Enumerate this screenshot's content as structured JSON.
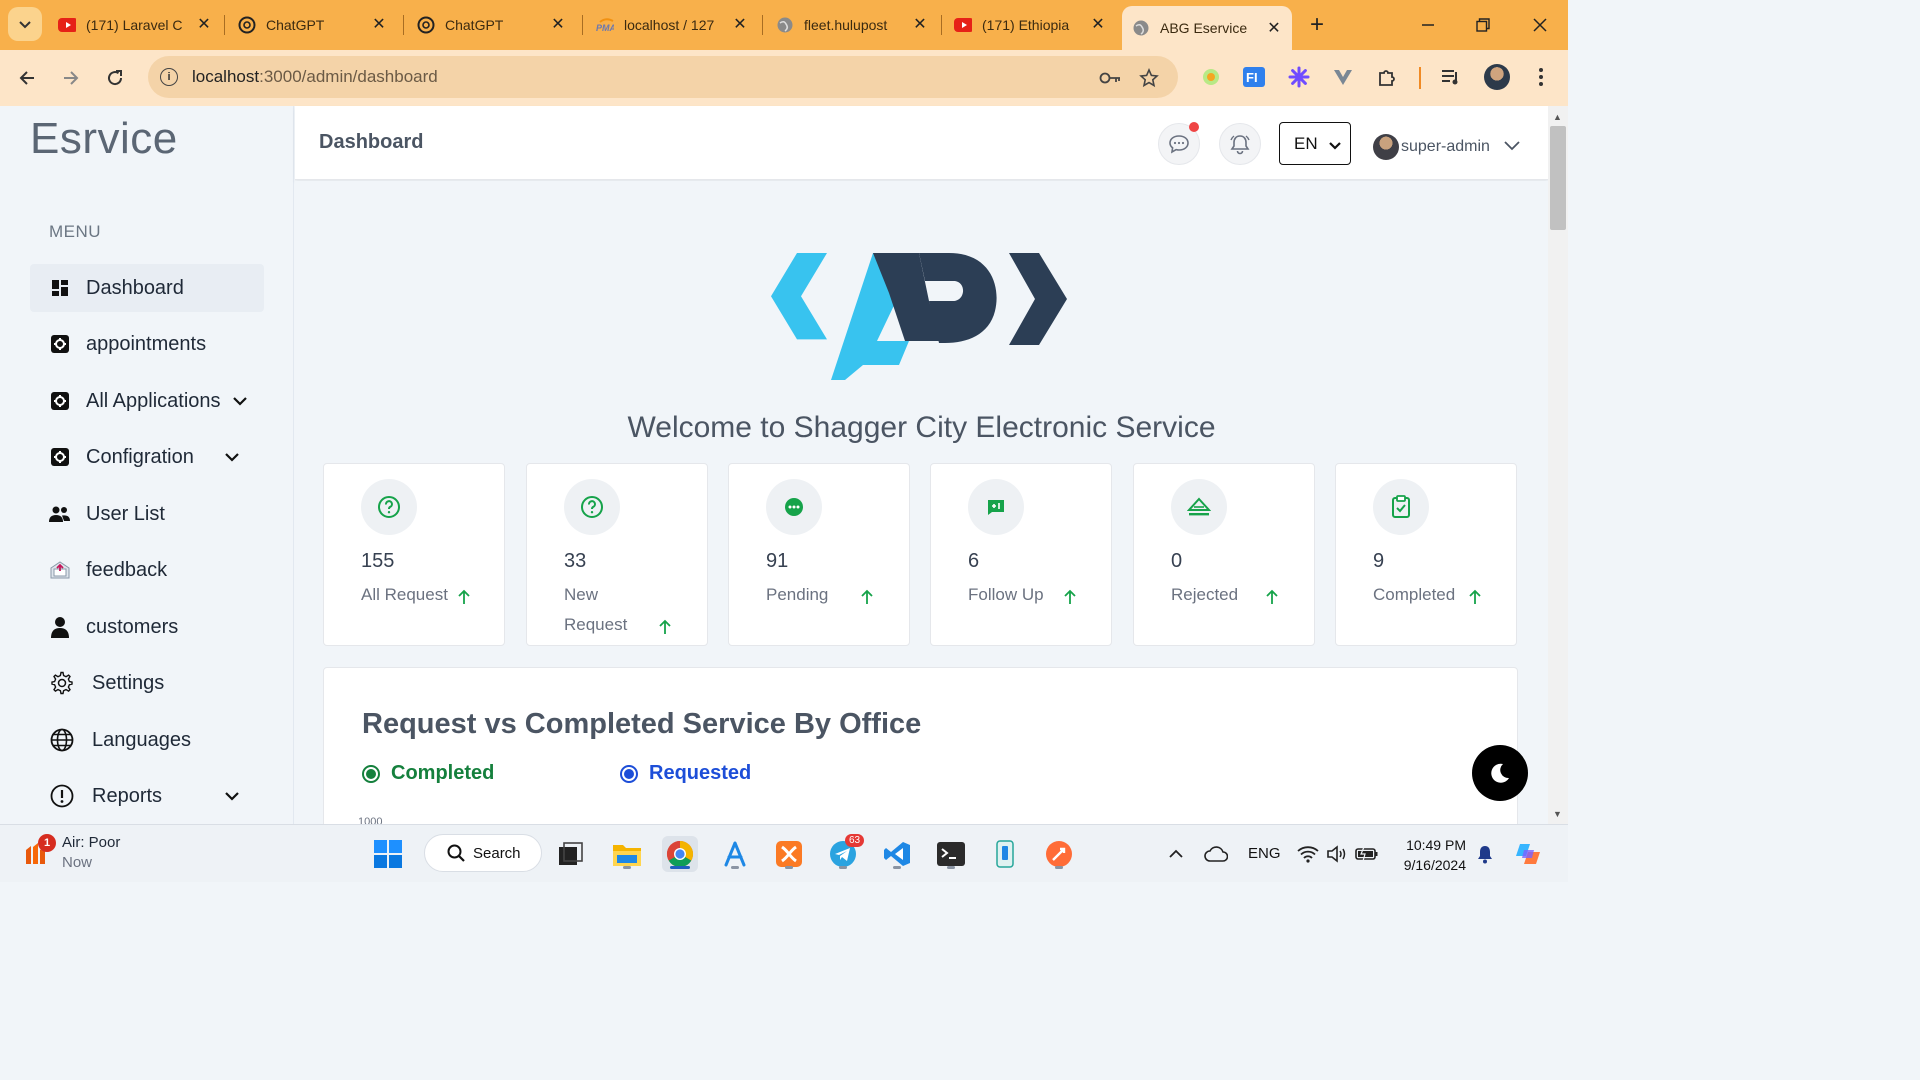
{
  "browser": {
    "tabs": [
      {
        "label": "(171) Laravel C",
        "favicon": "youtube-icon"
      },
      {
        "label": "ChatGPT",
        "favicon": "chatgpt-icon"
      },
      {
        "label": "ChatGPT",
        "favicon": "chatgpt-icon"
      },
      {
        "label": "localhost / 127",
        "favicon": "phpmyadmin-icon"
      },
      {
        "label": "fleet.hulupost",
        "favicon": "globe-icon"
      },
      {
        "label": "(171) Ethiopia",
        "favicon": "youtube-icon"
      },
      {
        "label": "ABG Eservice",
        "favicon": "globe-icon",
        "active": true
      }
    ],
    "close_glyph": "✕",
    "new_tab_glyph": "+",
    "url_host": "localhost",
    "url_path": ":3000/admin/dashboard"
  },
  "sidebar": {
    "brand": "Esrvice",
    "menu_title": "MENU",
    "items": [
      {
        "label": "Dashboard",
        "icon": "grid-icon",
        "active": true
      },
      {
        "label": "appointments",
        "icon": "cog-box-icon"
      },
      {
        "label": "All Applications",
        "icon": "cog-box-icon",
        "dropdown": true
      },
      {
        "label": "Configration",
        "icon": "cog-box-icon",
        "dropdown": true
      },
      {
        "label": "User List",
        "icon": "users-icon"
      },
      {
        "label": "feedback",
        "icon": "feedback-icon"
      },
      {
        "label": "customers",
        "icon": "user-icon"
      },
      {
        "label": "Settings",
        "icon": "gear-icon"
      },
      {
        "label": "Languages",
        "icon": "globe-icon"
      },
      {
        "label": "Reports",
        "icon": "alert-icon",
        "dropdown": true
      }
    ]
  },
  "header": {
    "title": "Dashboard",
    "language": "EN",
    "username": "super-admin"
  },
  "main": {
    "welcome": "Welcome to Shagger City Electronic Service",
    "stats": [
      {
        "count": "155",
        "label": "All Request",
        "icon": "question-circle-icon"
      },
      {
        "count": "33",
        "label": "New Request",
        "icon": "question-circle-icon"
      },
      {
        "count": "91",
        "label": "Pending",
        "icon": "ellipsis-circle-icon"
      },
      {
        "count": "6",
        "label": "Follow Up",
        "icon": "message-plus-icon"
      },
      {
        "count": "0",
        "label": "Rejected",
        "icon": "eject-icon"
      },
      {
        "count": "9",
        "label": "Completed",
        "icon": "clipboard-check-icon"
      }
    ],
    "chart": {
      "title": "Request vs Completed Service By Office",
      "legend": [
        {
          "label": "Completed",
          "color": "#15803d"
        },
        {
          "label": "Requested",
          "color": "#1d4ed8"
        }
      ],
      "first_tick": "1000"
    }
  },
  "colors": {
    "logo_light": "#38c3ef",
    "logo_dark": "#2c3e55",
    "stat_icon": "#16a34a",
    "tab_bar": "#f8b04b"
  },
  "taskbar": {
    "weather_title": "Air: Poor",
    "weather_sub": "Now",
    "weather_badge": "1",
    "search_label": "Search",
    "telegram_badge": "63",
    "lang": "ENG",
    "time": "10:49 PM",
    "date": "9/16/2024"
  }
}
